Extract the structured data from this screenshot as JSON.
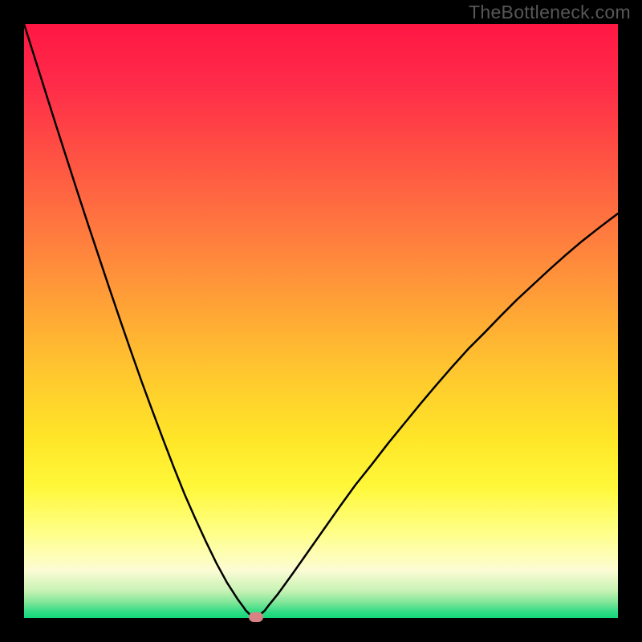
{
  "watermark_text": "TheBottleneck.com",
  "chart_data": {
    "type": "line",
    "title": "",
    "xlabel": "",
    "ylabel": "",
    "x_range": [
      0,
      100
    ],
    "y_range": [
      0,
      100
    ],
    "background_gradient": {
      "stops": [
        {
          "offset": 0.0,
          "color": "#ff1744"
        },
        {
          "offset": 0.1,
          "color": "#ff2b49"
        },
        {
          "offset": 0.2,
          "color": "#ff4a44"
        },
        {
          "offset": 0.3,
          "color": "#ff6a41"
        },
        {
          "offset": 0.4,
          "color": "#ff8a3c"
        },
        {
          "offset": 0.5,
          "color": "#ffab34"
        },
        {
          "offset": 0.6,
          "color": "#ffcb2e"
        },
        {
          "offset": 0.7,
          "color": "#ffe628"
        },
        {
          "offset": 0.78,
          "color": "#fff83a"
        },
        {
          "offset": 0.86,
          "color": "#ffff8c"
        },
        {
          "offset": 0.92,
          "color": "#fcfcd4"
        },
        {
          "offset": 0.955,
          "color": "#c6f2b4"
        },
        {
          "offset": 0.975,
          "color": "#7be597"
        },
        {
          "offset": 0.99,
          "color": "#2fdc85"
        },
        {
          "offset": 1.0,
          "color": "#13d877"
        }
      ]
    },
    "series": [
      {
        "name": "bottleneck-curve",
        "color": "#000000",
        "stroke_width": 2.5,
        "x": [
          0.0,
          1.8,
          3.6,
          5.4,
          7.2,
          9.0,
          10.8,
          12.6,
          14.4,
          16.2,
          18.0,
          19.8,
          21.6,
          23.4,
          25.2,
          27.0,
          28.8,
          30.6,
          32.4,
          34.2,
          36.0,
          36.9,
          37.3,
          37.8,
          38.0,
          38.3,
          38.8,
          39.2,
          39.4,
          39.8,
          40.5,
          41.1,
          42.8,
          45.4,
          48.0,
          50.6,
          53.2,
          55.8,
          58.6,
          61.3,
          64.0,
          66.7,
          69.4,
          72.1,
          74.8,
          77.6,
          80.3,
          83.0,
          85.8,
          88.5,
          91.2,
          93.9,
          96.7,
          100.0
        ],
        "y": [
          100.0,
          94.3,
          88.6,
          82.9,
          77.3,
          71.7,
          66.2,
          60.8,
          55.4,
          50.1,
          44.9,
          39.8,
          34.9,
          30.1,
          25.4,
          20.9,
          16.8,
          12.9,
          9.2,
          5.9,
          3.1,
          1.9,
          1.3,
          0.8,
          0.6,
          0.45,
          0.3,
          0.3,
          0.35,
          0.6,
          1.2,
          2.0,
          4.1,
          7.7,
          11.4,
          15.1,
          18.8,
          22.4,
          25.9,
          29.4,
          32.7,
          36.0,
          39.2,
          42.3,
          45.3,
          48.1,
          50.9,
          53.6,
          56.2,
          58.7,
          61.1,
          63.4,
          65.6,
          68.1
        ]
      }
    ],
    "marker": {
      "name": "optimal-point",
      "x": 39.0,
      "y": 0.1,
      "color": "#d98285"
    },
    "annotations": []
  }
}
